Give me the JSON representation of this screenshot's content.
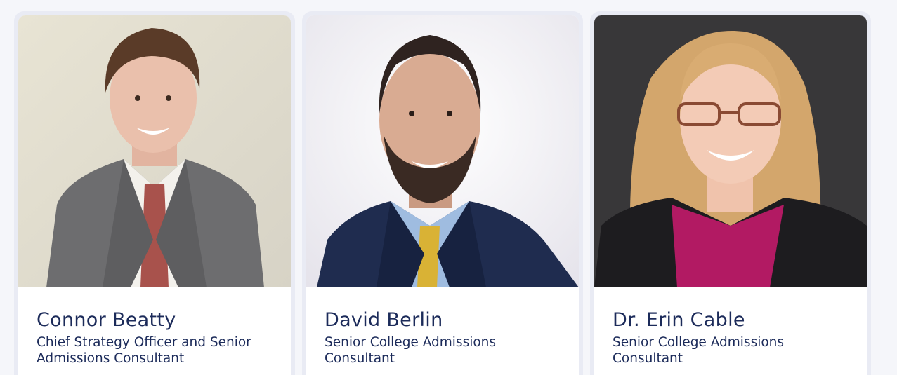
{
  "team": [
    {
      "name": "Connor Beatty",
      "title": "Chief Strategy Officer and Senior Admissions Consultant"
    },
    {
      "name": "David Berlin",
      "title": "Senior College Admissions Consultant"
    },
    {
      "name": "Dr. Erin Cable",
      "title": "Senior College Admissions Consultant"
    }
  ]
}
